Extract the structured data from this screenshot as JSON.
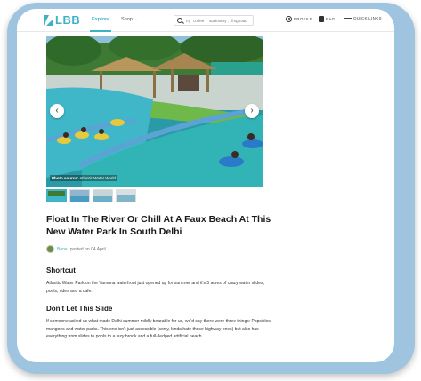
{
  "header": {
    "logo_text": "LBB",
    "nav": [
      {
        "label": "Explore",
        "active": true
      },
      {
        "label": "Shop"
      }
    ],
    "search_placeholder": "Try \"coffee\", \"stationery\", \"fmg road\"",
    "profile_label": "PROFILE",
    "bag_label": "BAG",
    "quick_links_label": "QUICK LINKS",
    "accent_color": "#3bb3c3"
  },
  "hero": {
    "credit_label": "Photo source:",
    "credit_value": "Atlantic Water World",
    "prev_icon": "chevron-left-icon",
    "next_icon": "chevron-right-icon",
    "thumbnail_count": 4,
    "active_thumbnail": 1
  },
  "article": {
    "title": "Float In The River Or Chill At A Faux Beach At This New Water Park In South Delhi",
    "author": "Bene",
    "posted_text": "posted on 04 April",
    "sections": [
      {
        "heading": "Shortcut",
        "body": "Atlantic Water Park on the Yamuna waterfront just opened up for summer and it's 5 acres of crazy water slides, pools, rides and a cafe."
      },
      {
        "heading": "Don't Let This Slide",
        "body": "If someone asked us what made Delhi summer mildly bearable for us, we'd say there were three things: Popsicles, mangoes and water parks. This one isn't just accessible (sorry, kinda hate those highway ones) but also has everything from slides to pools to a lazy brook and a full-fledged artificial beach."
      }
    ]
  }
}
